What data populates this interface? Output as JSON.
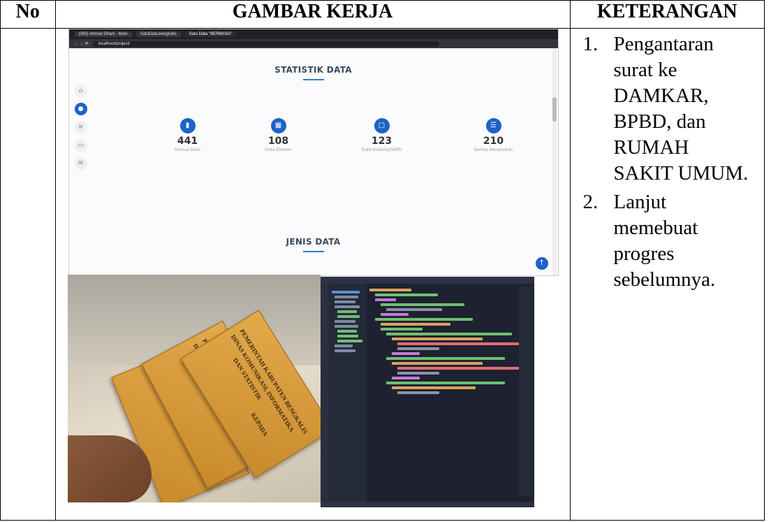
{
  "table": {
    "headers": {
      "no": "No",
      "gambar": "GAMBAR KERJA",
      "keterangan": "KETERANGAN"
    },
    "keterangan": [
      {
        "num": "1.",
        "text": "Pengantaran surat ke DAMKAR, BPBD, dan RUMAH SAKIT UMUM."
      },
      {
        "num": "2.",
        "text": "Lanjut memebuat progres sebelumnya."
      }
    ]
  },
  "browser": {
    "tabs": [
      "(365) Ahmad Dhani - Mani",
      "SatuData.bengkalis",
      "Satu Data \"BERMASA\""
    ],
    "url": "localhost/project/",
    "section_title": "STATISTIK DATA",
    "stats": [
      {
        "value": "441",
        "label": "Semua Data",
        "icon": "chart-icon"
      },
      {
        "value": "108",
        "label": "Data Elemen",
        "icon": "calendar-icon"
      },
      {
        "value": "123",
        "label": "Data Instansi/SKPD",
        "icon": "folder-icon"
      },
      {
        "value": "210",
        "label": "Semua Kecamatan",
        "icon": "list-icon"
      }
    ],
    "section_title_2": "JENIS DATA",
    "sidebar_icons": [
      "home-icon",
      "user-icon",
      "layers-icon",
      "image-icon",
      "mail-icon"
    ]
  },
  "photo": {
    "envelope_texts": [
      "PEMERINTAH KABUPATEN BENGKALIS",
      "DINAS KOMUNIKASI, INFORMATIKA",
      "DAN STATISTIK",
      "KEPADA"
    ]
  },
  "colors": {
    "accent": "#1d62c9",
    "envelope": "#d99a3a",
    "editor_bg": "#1e2230"
  }
}
